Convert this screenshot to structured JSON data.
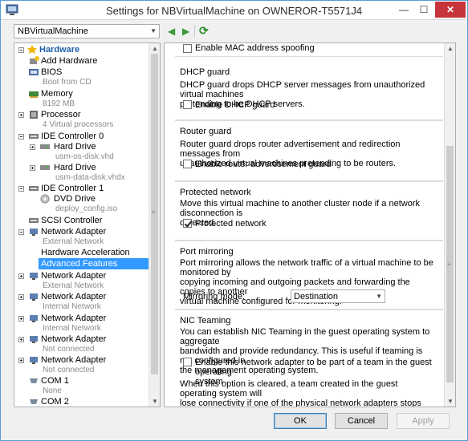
{
  "window": {
    "title": "Settings for NBVirtualMachine on OWNEROR-T5571J4",
    "min_glyph": "—",
    "max_glyph": "☐",
    "close_glyph": "✕"
  },
  "vm_selector": {
    "value": "NBVirtualMachine"
  },
  "nav": {
    "back_glyph": "◀",
    "forward_glyph": "▶",
    "refresh_glyph": "⟳"
  },
  "tree": {
    "hardware": "Hardware",
    "items": [
      {
        "label": "Add Hardware"
      },
      {
        "label": "BIOS",
        "sub": "Boot from CD"
      },
      {
        "label": "Memory",
        "sub": "8192 MB"
      },
      {
        "label": "Processor",
        "sub": "4 Virtual processors"
      },
      {
        "label": "IDE Controller 0"
      },
      {
        "label": "Hard Drive",
        "sub": "usm-os-disk.vhd"
      },
      {
        "label": "Hard Drive",
        "sub": "usm-data-disk.vhdx"
      },
      {
        "label": "IDE Controller 1"
      },
      {
        "label": "DVD Drive",
        "sub": "deploy_config.iso"
      },
      {
        "label": "SCSI Controller"
      },
      {
        "label": "Network Adapter",
        "sub": "External Network"
      },
      {
        "label": "Hardware Acceleration"
      },
      {
        "label": "Advanced Features"
      },
      {
        "label": "Network Adapter",
        "sub": "External Network"
      },
      {
        "label": "Network Adapter",
        "sub": "Internal Network"
      },
      {
        "label": "Network Adapter",
        "sub": "Internal Network"
      },
      {
        "label": "Network Adapter",
        "sub": "Not connected"
      },
      {
        "label": "Network Adapter",
        "sub": "Not connected"
      },
      {
        "label": "COM 1",
        "sub": "None"
      },
      {
        "label": "COM 2"
      }
    ]
  },
  "settings": {
    "mac_spoofing_label": "Enable MAC address spoofing",
    "dhcp": {
      "title": "DHCP guard",
      "desc1": "DHCP guard drops DHCP server messages from unauthorized virtual machines",
      "desc2": "pretending to be DHCP servers.",
      "check_label": "Enable DHCP guard",
      "checked": false
    },
    "router": {
      "title": "Router guard",
      "desc1": "Router guard drops router advertisement and redirection messages from",
      "desc2": "unauthorized virtual machines pretending to be routers.",
      "check_label": "Enable router advertisement guard",
      "checked": false
    },
    "protected": {
      "title": "Protected network",
      "desc1": "Move this virtual machine to another cluster node if a network disconnection is",
      "desc2": "detected.",
      "check_label": "Protected network",
      "checked": true
    },
    "mirroring": {
      "title": "Port mirroring",
      "desc1": "Port mirroring allows the network traffic of a virtual machine to be monitored by",
      "desc2": "copying incoming and outgoing packets and forwarding the copies to another",
      "desc3": "virtual machine configured for monitoring.",
      "mode_label": "Mirroring mode:",
      "mode_value": "Destination"
    },
    "teaming": {
      "title": "NIC Teaming",
      "desc1": "You can establish NIC Teaming in the guest operating system to aggregate",
      "desc2": "bandwidth and provide redundancy. This is useful if teaming is not configured in",
      "desc3": "the management operating system.",
      "check_line1": "Enable this network adapter to be part of a team in the guest operating",
      "check_line2": "system",
      "checked": false,
      "note1": "When this option is cleared, a team created in the guest operating system will",
      "note2": "lose connectivity if one of the physical network adapters stops working."
    }
  },
  "buttons": {
    "ok": "OK",
    "cancel": "Cancel",
    "apply": "Apply"
  },
  "scroll": {
    "up": "▲",
    "down": "▼",
    "grip": "≡"
  }
}
